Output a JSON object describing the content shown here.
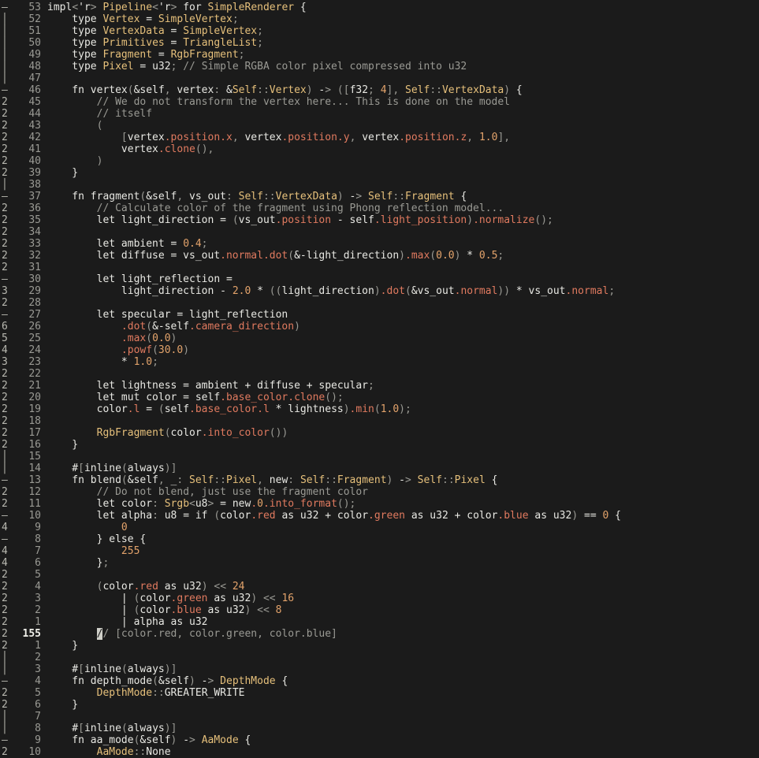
{
  "editor": {
    "current_line": 36,
    "lines": [
      {
        "fold": "–",
        "num": "53",
        "code": "impl<'r> Pipeline<'r> for SimpleRenderer {"
      },
      {
        "fold": "│",
        "num": "52",
        "code": "    type Vertex = SimpleVertex;"
      },
      {
        "fold": "│",
        "num": "51",
        "code": "    type VertexData = SimpleVertex;"
      },
      {
        "fold": "│",
        "num": "50",
        "code": "    type Primitives = TriangleList;"
      },
      {
        "fold": "│",
        "num": "49",
        "code": "    type Fragment = RgbFragment;"
      },
      {
        "fold": "│",
        "num": "48",
        "code": "    type Pixel = u32; // Simple RGBA color pixel compressed into u32"
      },
      {
        "fold": "│",
        "num": "47",
        "code": ""
      },
      {
        "fold": "–",
        "num": "46",
        "code": "    fn vertex(&self, vertex: &Self::Vertex) -> ([f32; 4], Self::VertexData) {"
      },
      {
        "fold": "2",
        "num": "45",
        "code": "        // We do not transform the vertex here... This is done on the model"
      },
      {
        "fold": "2",
        "num": "44",
        "code": "        // itself"
      },
      {
        "fold": "2",
        "num": "43",
        "code": "        ("
      },
      {
        "fold": "2",
        "num": "42",
        "code": "            [vertex.position.x, vertex.position.y, vertex.position.z, 1.0],"
      },
      {
        "fold": "2",
        "num": "41",
        "code": "            vertex.clone(),"
      },
      {
        "fold": "2",
        "num": "40",
        "code": "        )"
      },
      {
        "fold": "2",
        "num": "39",
        "code": "    }"
      },
      {
        "fold": "│",
        "num": "38",
        "code": ""
      },
      {
        "fold": "–",
        "num": "37",
        "code": "    fn fragment(&self, vs_out: Self::VertexData) -> Self::Fragment {"
      },
      {
        "fold": "2",
        "num": "36",
        "code": "        // Calculate color of the fragment using Phong reflection model..."
      },
      {
        "fold": "2",
        "num": "35",
        "code": "        let light_direction = (vs_out.position - self.light_position).normalize();"
      },
      {
        "fold": "2",
        "num": "34",
        "code": ""
      },
      {
        "fold": "2",
        "num": "33",
        "code": "        let ambient = 0.4;"
      },
      {
        "fold": "2",
        "num": "32",
        "code": "        let diffuse = vs_out.normal.dot(&-light_direction).max(0.0) * 0.5;"
      },
      {
        "fold": "2",
        "num": "31",
        "code": ""
      },
      {
        "fold": "–",
        "num": "30",
        "code": "        let light_reflection ="
      },
      {
        "fold": "3",
        "num": "29",
        "code": "            light_direction - 2.0 * ((light_direction).dot(&vs_out.normal)) * vs_out.normal;"
      },
      {
        "fold": "2",
        "num": "28",
        "code": ""
      },
      {
        "fold": "–",
        "num": "27",
        "code": "        let specular = light_reflection"
      },
      {
        "fold": "6",
        "num": "26",
        "code": "            .dot(&-self.camera_direction)"
      },
      {
        "fold": "5",
        "num": "25",
        "code": "            .max(0.0)"
      },
      {
        "fold": "4",
        "num": "24",
        "code": "            .powf(30.0)"
      },
      {
        "fold": "3",
        "num": "23",
        "code": "            * 1.0;"
      },
      {
        "fold": "2",
        "num": "22",
        "code": ""
      },
      {
        "fold": "2",
        "num": "21",
        "code": "        let lightness = ambient + diffuse + specular;"
      },
      {
        "fold": "2",
        "num": "20",
        "code": "        let mut color = self.base_color.clone();"
      },
      {
        "fold": "2",
        "num": "19",
        "code": "        color.l = (self.base_color.l * lightness).min(1.0);"
      },
      {
        "fold": "2",
        "num": "18",
        "code": ""
      },
      {
        "fold": "2",
        "num": "17",
        "code": "        RgbFragment(color.into_color())"
      },
      {
        "fold": "2",
        "num": "16",
        "code": "    }"
      },
      {
        "fold": "│",
        "num": "15",
        "code": ""
      },
      {
        "fold": "│",
        "num": "14",
        "code": "    #[inline(always)]"
      },
      {
        "fold": "–",
        "num": "13",
        "code": "    fn blend(&self, _: Self::Pixel, new: Self::Fragment) -> Self::Pixel {"
      },
      {
        "fold": "2",
        "num": "12",
        "code": "        // Do not blend, just use the fragment color"
      },
      {
        "fold": "2",
        "num": "11",
        "code": "        let color: Srgb<u8> = new.0.into_format();"
      },
      {
        "fold": "–",
        "num": "10",
        "code": "        let alpha: u8 = if (color.red as u32 + color.green as u32 + color.blue as u32) == 0 {"
      },
      {
        "fold": "4",
        "num": "9",
        "code": "            0"
      },
      {
        "fold": "–",
        "num": "8",
        "code": "        } else {"
      },
      {
        "fold": "4",
        "num": "7",
        "code": "            255"
      },
      {
        "fold": "4",
        "num": "6",
        "code": "        };"
      },
      {
        "fold": "2",
        "num": "5",
        "code": ""
      },
      {
        "fold": "2",
        "num": "4",
        "code": "        (color.red as u32) << 24"
      },
      {
        "fold": "2",
        "num": "3",
        "code": "            | (color.green as u32) << 16"
      },
      {
        "fold": "2",
        "num": "2",
        "code": "            | (color.blue as u32) << 8"
      },
      {
        "fold": "2",
        "num": "1",
        "code": "            | alpha as u32"
      },
      {
        "fold": "2",
        "num": "155",
        "code": "        // [color.red, color.green, color.blue]"
      },
      {
        "fold": "2",
        "num": "1",
        "code": "    }"
      },
      {
        "fold": "│",
        "num": "2",
        "code": ""
      },
      {
        "fold": "│",
        "num": "3",
        "code": "    #[inline(always)]"
      },
      {
        "fold": "–",
        "num": "4",
        "code": "    fn depth_mode(&self) -> DepthMode {"
      },
      {
        "fold": "2",
        "num": "5",
        "code": "        DepthMode::GREATER_WRITE"
      },
      {
        "fold": "2",
        "num": "6",
        "code": "    }"
      },
      {
        "fold": "│",
        "num": "7",
        "code": ""
      },
      {
        "fold": "│",
        "num": "8",
        "code": "    #[inline(always)]"
      },
      {
        "fold": "–",
        "num": "9",
        "code": "    fn aa_mode(&self) -> AaMode {"
      },
      {
        "fold": "2",
        "num": "10",
        "code": "        AaMode::None"
      }
    ]
  },
  "colors": {
    "background": "#1b1b1b",
    "keyword": "#e8e8e3",
    "type": "#e6c07b",
    "field": "#e07a5f",
    "comment": "#9a9a94",
    "number": "#e3a36b",
    "punct": "#9a9a94"
  }
}
